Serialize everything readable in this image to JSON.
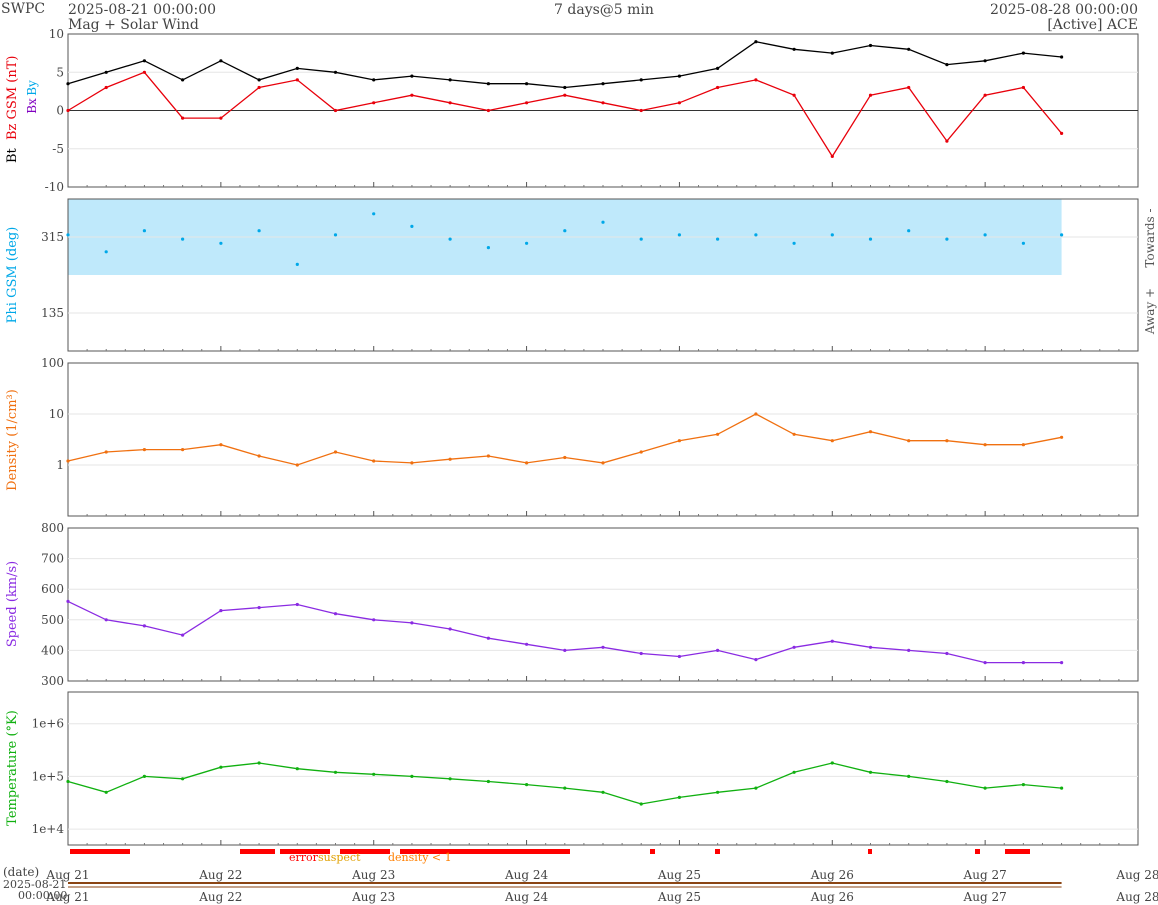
{
  "header": {
    "org": "SWPC",
    "start_time": "2025-08-21 00:00:00",
    "subtitle": "Mag + Solar Wind",
    "window": "7 days@5 min",
    "end_time": "2025-08-28 00:00:00",
    "source": "[Active] ACE"
  },
  "colors": {
    "bt": "#000000",
    "bz": "#e8000b",
    "bx": "#8000c0",
    "by": "#00a8e8",
    "phi": "#00a8e8",
    "phi_towards_band": "#bfe9fb",
    "phi_away_band": "#f7bcbc",
    "density": "#f07010",
    "speed": "#8a2be2",
    "temperature": "#10b010",
    "error": "#ff0000",
    "suspect": "#ffc000",
    "density_low": "#ff7f00"
  },
  "x_axis": {
    "ticks": [
      "Aug 21",
      "Aug 22",
      "Aug 23",
      "Aug 24",
      "Aug 25",
      "Aug 26",
      "Aug 27",
      "Aug 28"
    ],
    "range_days": [
      0,
      7
    ],
    "date_label": "(date)",
    "overview_label_date": "2025-08-21",
    "overview_label_time": "00:00:00"
  },
  "flags": {
    "error_label": "error",
    "suspect_label": "suspect",
    "density_label": "density < 1"
  },
  "chart_data": [
    {
      "type": "line",
      "panel": "mag",
      "ylabel_parts": [
        "Bt",
        "Bz GSM (nT)"
      ],
      "legend": [
        "Bx",
        "By"
      ],
      "ylim": [
        -10,
        10
      ],
      "yticks": [
        "10",
        "5",
        "0",
        "-5",
        "-10"
      ],
      "grid": true,
      "series": [
        {
          "name": "Bt",
          "x_days": [
            0,
            0.25,
            0.5,
            0.75,
            1,
            1.25,
            1.5,
            1.75,
            2,
            2.25,
            2.5,
            2.75,
            3,
            3.25,
            3.5,
            3.75,
            4,
            4.25,
            4.5,
            4.75,
            5,
            5.25,
            5.5,
            5.75,
            6,
            6.25,
            6.5
          ],
          "values": [
            3.5,
            5,
            6.5,
            4,
            6.5,
            4,
            5.5,
            5,
            4,
            4.5,
            4,
            3.5,
            3.5,
            3,
            3.5,
            4,
            4.5,
            5.5,
            9,
            8,
            7.5,
            8.5,
            8,
            6,
            6.5,
            7.5,
            7
          ]
        },
        {
          "name": "Bz",
          "x_days": [
            0,
            0.25,
            0.5,
            0.75,
            1,
            1.25,
            1.5,
            1.75,
            2,
            2.25,
            2.5,
            2.75,
            3,
            3.25,
            3.5,
            3.75,
            4,
            4.25,
            4.5,
            4.75,
            5,
            5.25,
            5.5,
            5.75,
            6,
            6.25,
            6.5
          ],
          "values": [
            0,
            3,
            5,
            -1,
            -1,
            3,
            4,
            0,
            1,
            2,
            1,
            0,
            1,
            2,
            1,
            0,
            1,
            3,
            4,
            2,
            -6,
            2,
            3,
            -4,
            2,
            3,
            -3
          ]
        }
      ]
    },
    {
      "type": "scatter",
      "panel": "phi",
      "ylabel": "Phi GSM (deg)",
      "ylim": [
        45,
        405
      ],
      "yticks": [
        "315",
        "135"
      ],
      "right_labels": [
        "Towards -",
        "Away +"
      ],
      "series": [
        {
          "name": "Phi GSM",
          "x_days": [
            0,
            0.25,
            0.5,
            0.75,
            1,
            1.25,
            1.5,
            1.75,
            2,
            2.25,
            2.5,
            2.75,
            3,
            3.25,
            3.5,
            3.75,
            4,
            4.25,
            4.5,
            4.75,
            5,
            5.25,
            5.5,
            5.75,
            6,
            6.25,
            6.5
          ],
          "values": [
            320,
            280,
            330,
            310,
            300,
            330,
            250,
            320,
            370,
            340,
            310,
            290,
            300,
            330,
            350,
            310,
            320,
            310,
            320,
            300,
            320,
            310,
            330,
            310,
            320,
            300,
            320
          ]
        }
      ]
    },
    {
      "type": "line",
      "panel": "density",
      "ylabel": "Density (1/cm³)",
      "scale": "log",
      "ylim": [
        0.1,
        100
      ],
      "yticks": [
        "100",
        "10",
        "1"
      ],
      "series": [
        {
          "name": "Density",
          "x_days": [
            0,
            0.25,
            0.5,
            0.75,
            1,
            1.25,
            1.5,
            1.75,
            2,
            2.25,
            2.5,
            2.75,
            3,
            3.25,
            3.5,
            3.75,
            4,
            4.25,
            4.5,
            4.75,
            5,
            5.25,
            5.5,
            5.75,
            6,
            6.25,
            6.5
          ],
          "values": [
            1.2,
            1.8,
            2,
            2,
            2.5,
            1.5,
            1,
            1.8,
            1.2,
            1.1,
            1.3,
            1.5,
            1.1,
            1.4,
            1.1,
            1.8,
            3,
            4,
            10,
            4,
            3,
            4.5,
            3,
            3,
            2.5,
            2.5,
            3.5
          ]
        }
      ]
    },
    {
      "type": "line",
      "panel": "speed",
      "ylabel": "Speed (km/s)",
      "ylim": [
        300,
        800
      ],
      "yticks": [
        "800",
        "700",
        "600",
        "500",
        "400",
        "300"
      ],
      "series": [
        {
          "name": "Speed",
          "x_days": [
            0,
            0.25,
            0.5,
            0.75,
            1,
            1.25,
            1.5,
            1.75,
            2,
            2.25,
            2.5,
            2.75,
            3,
            3.25,
            3.5,
            3.75,
            4,
            4.25,
            4.5,
            4.75,
            5,
            5.25,
            5.5,
            5.75,
            6,
            6.25,
            6.5
          ],
          "values": [
            560,
            500,
            480,
            450,
            530,
            540,
            550,
            520,
            500,
            490,
            470,
            440,
            420,
            400,
            410,
            390,
            380,
            400,
            370,
            410,
            430,
            410,
            400,
            390,
            360,
            360,
            360
          ]
        }
      ]
    },
    {
      "type": "line",
      "panel": "temperature",
      "ylabel": "Temperature (°K)",
      "scale": "log",
      "ylim": [
        5000,
        4000000
      ],
      "yticks": [
        "1e+6",
        "1e+5",
        "1e+4"
      ],
      "series": [
        {
          "name": "Temperature",
          "x_days": [
            0,
            0.25,
            0.5,
            0.75,
            1,
            1.25,
            1.5,
            1.75,
            2,
            2.25,
            2.5,
            2.75,
            3,
            3.25,
            3.5,
            3.75,
            4,
            4.25,
            4.5,
            4.75,
            5,
            5.25,
            5.5,
            5.75,
            6,
            6.25,
            6.5
          ],
          "values": [
            80000,
            50000,
            100000,
            90000,
            150000,
            180000,
            140000,
            120000,
            110000,
            100000,
            90000,
            80000,
            70000,
            60000,
            50000,
            30000,
            40000,
            50000,
            60000,
            120000,
            180000,
            120000,
            100000,
            80000,
            60000,
            70000,
            60000
          ]
        }
      ]
    }
  ]
}
